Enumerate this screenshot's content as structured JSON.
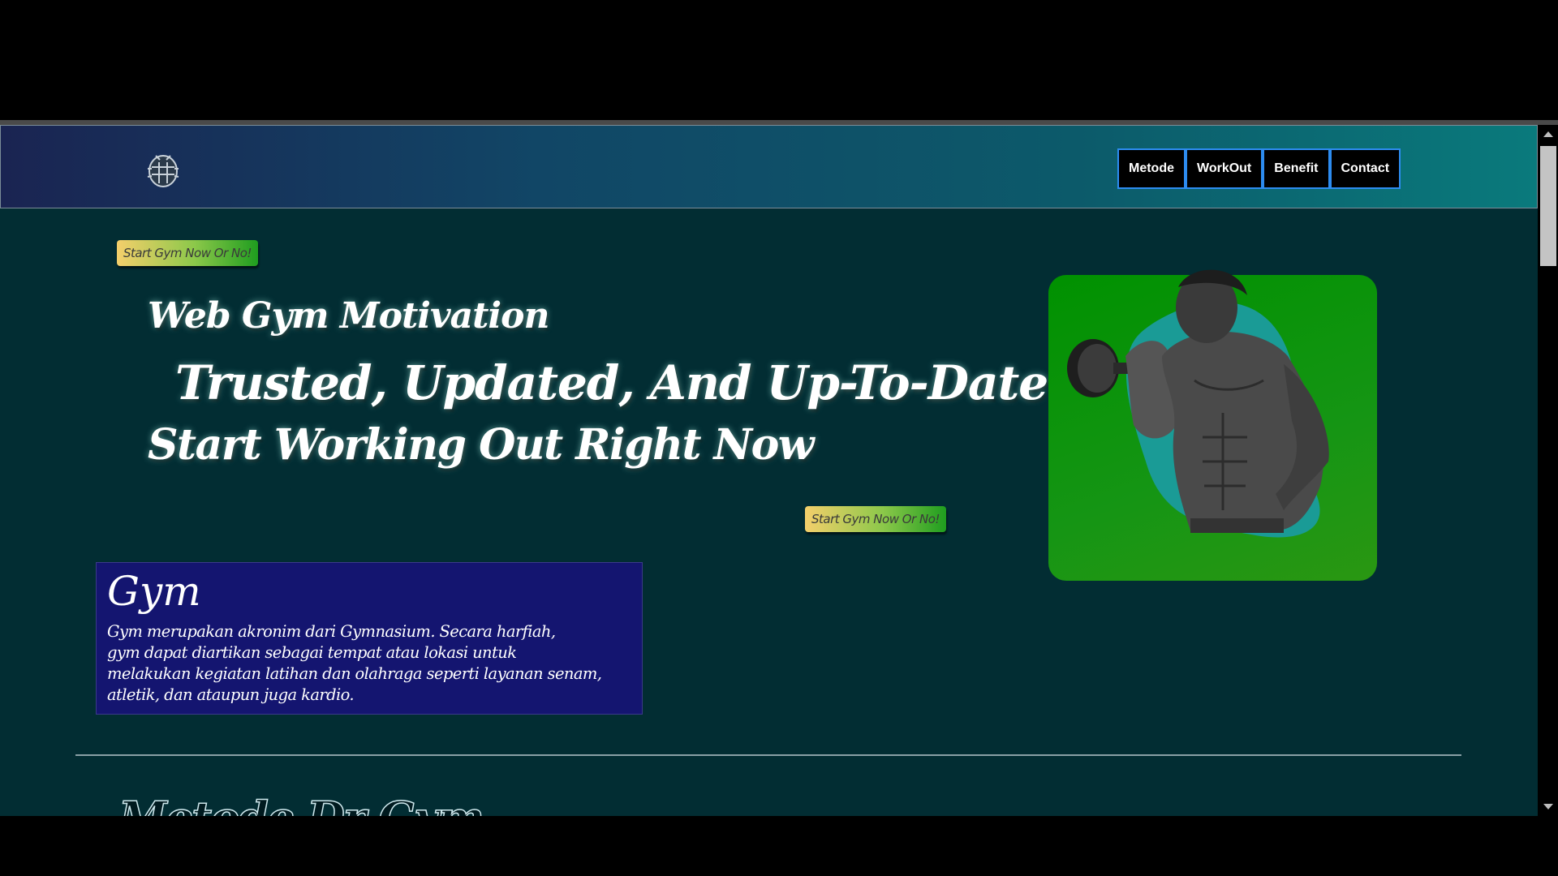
{
  "nav": {
    "logo_icon": "shield-bug-logo-icon",
    "items": [
      {
        "label": "Metode"
      },
      {
        "label": "WorkOut"
      },
      {
        "label": "Benefit"
      },
      {
        "label": "Contact"
      }
    ]
  },
  "hero": {
    "badge_top": "Start Gym Now Or No!",
    "title_1": "Web Gym Motivation",
    "title_2": "Trusted, Updated, And Up-To-Date",
    "title_3": "Start Working Out Right Now",
    "badge_bottom": "Start Gym Now Or No!",
    "image_icon": "bodybuilder-dumbbell-image"
  },
  "gym": {
    "heading": "Gym",
    "line_1": "Gym merupakan akronim dari Gymnasium. Secara harfiah,",
    "line_2": "gym dapat diartikan sebagai tempat atau lokasi untuk",
    "line_3": "melakukan kegiatan latihan dan olahraga seperti layanan senam,",
    "line_4": "atletik, dan ataupun juga kardio."
  },
  "section": {
    "title": "Metode Dr Gym"
  },
  "colors": {
    "page_bg": "#022d33",
    "nav_border": "#2d8cf0",
    "card_bg": "#141570",
    "image_bg": "#159514"
  }
}
